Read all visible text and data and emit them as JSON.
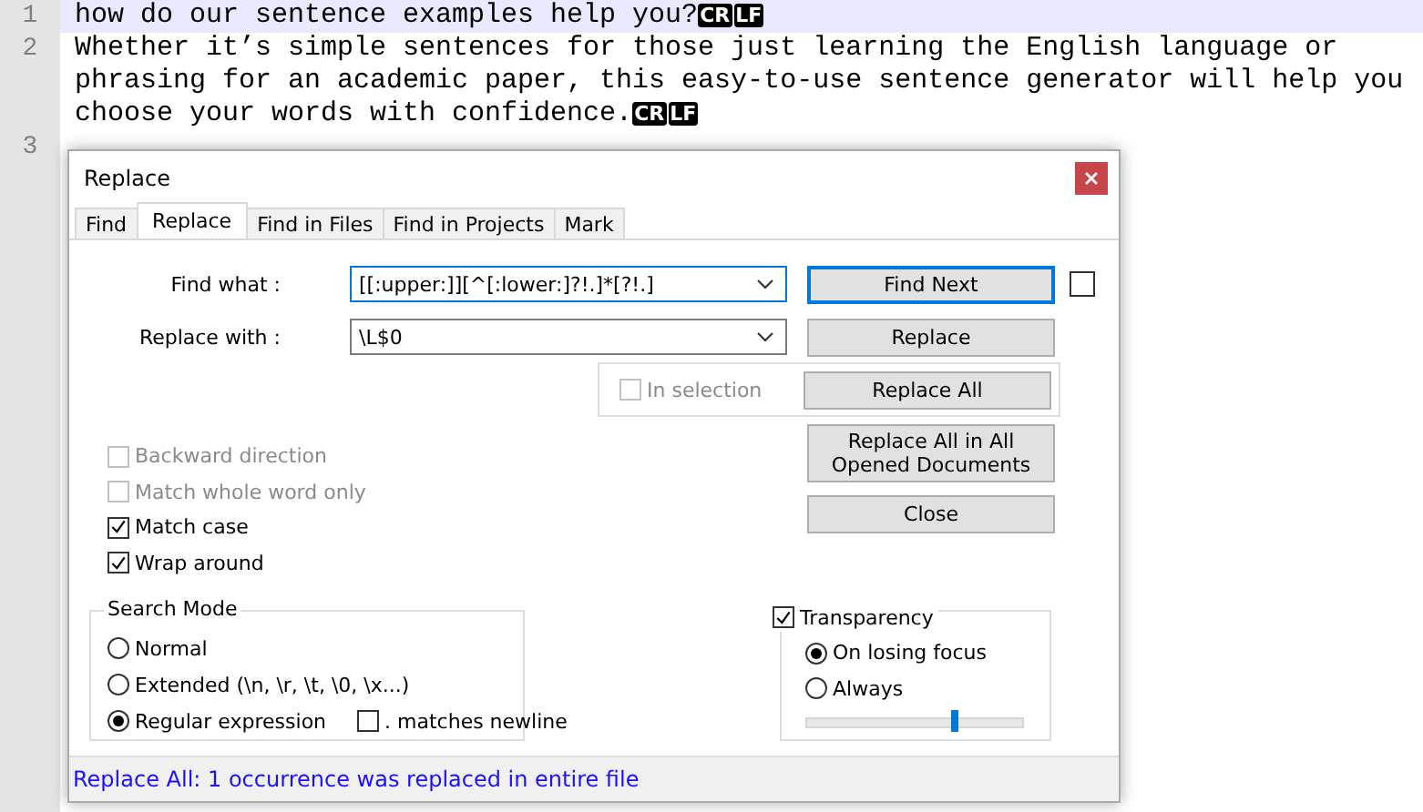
{
  "editor": {
    "lines": [
      {
        "number": "1",
        "rows": [
          "how do our sentence examples help you?"
        ],
        "eol": [
          "CR",
          "LF"
        ],
        "current": true
      },
      {
        "number": "2",
        "rows": [
          "Whether it’s simple sentences for those just learning the English language or",
          "phrasing for an academic paper, this easy-to-use sentence generator will help you",
          "choose your words with confidence."
        ],
        "eol": [
          "CR",
          "LF"
        ],
        "current": false
      },
      {
        "number": "3",
        "current": false
      }
    ]
  },
  "dialog": {
    "title": "Replace",
    "tabs": [
      {
        "label": "Find",
        "selected": false
      },
      {
        "label": "Replace",
        "selected": true
      },
      {
        "label": "Find in Files",
        "selected": false
      },
      {
        "label": "Find in Projects",
        "selected": false
      },
      {
        "label": "Mark",
        "selected": false
      }
    ],
    "fields": [
      {
        "label": "Find what :",
        "value": "[[:upper:]][^[:lower:]?!.]*[?!.]",
        "focused": true
      },
      {
        "label": "Replace with :",
        "value": "\\L$0",
        "focused": false
      }
    ],
    "find_next": {
      "label": "Find Next",
      "default": true
    },
    "find_next_checkbox": {
      "checked": false
    },
    "replace_button": "Replace",
    "in_selection": {
      "label": "In selection",
      "checked": false,
      "disabled": true
    },
    "replace_all_button": "Replace All",
    "replace_all_open_button": "Replace All in All Opened Documents",
    "close_button": "Close",
    "options": [
      {
        "label": "Backward direction",
        "checked": false,
        "disabled": true
      },
      {
        "label": "Match whole word only",
        "checked": false,
        "disabled": true
      },
      {
        "label": "Match case",
        "checked": true,
        "disabled": false
      },
      {
        "label": "Wrap around",
        "checked": true,
        "disabled": false
      }
    ],
    "search_mode": {
      "title": "Search Mode",
      "options": [
        {
          "label": "Normal",
          "selected": false
        },
        {
          "label": "Extended (\\n, \\r, \\t, \\0, \\x...)",
          "selected": false
        },
        {
          "label": "Regular expression",
          "selected": true
        }
      ],
      "dot_newline": {
        "label": ". matches newline",
        "checked": false
      }
    },
    "transparency": {
      "label": "Transparency",
      "checked": true,
      "options": [
        {
          "label": "On losing focus",
          "selected": true
        },
        {
          "label": "Always",
          "selected": false
        }
      ],
      "level": 0.69
    },
    "status": "Replace All: 1 occurrence was replaced in entire file"
  }
}
